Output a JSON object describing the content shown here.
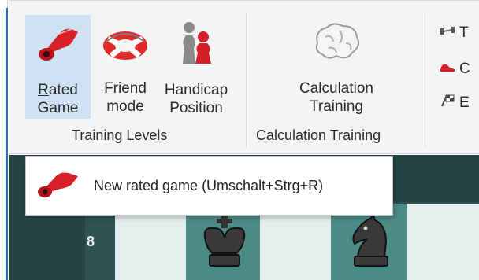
{
  "ribbon": {
    "training_levels": {
      "rated_game": {
        "mnemonic": "R",
        "line1_rest": "ated",
        "line2": "Game",
        "icon": "whistle-icon"
      },
      "friend_mode": {
        "mnemonic": "F",
        "line1_rest": "riend",
        "line2": "mode",
        "icon": "lifebuoy-icon"
      },
      "handicap_position": {
        "line1": "Handicap",
        "line2": "Position",
        "icon": "chess-pawns-icon"
      },
      "group_label": "Training Levels"
    },
    "calculation_training": {
      "button": {
        "line1": "Calculation",
        "line2": "Training",
        "icon": "brain-icon"
      },
      "group_label": "Calculation Training"
    },
    "side_items": [
      {
        "text": "T",
        "icon": "dumbbell-icon"
      },
      {
        "text": "C",
        "icon": "sneaker-icon"
      },
      {
        "text": "E",
        "icon": "checkered-flag-icon"
      }
    ]
  },
  "tooltip": {
    "text": "New rated game (Umschalt+Strg+R)",
    "icon": "whistle-icon"
  },
  "board": {
    "visible_rank": "8",
    "pieces": [
      "black-king",
      "black-knight"
    ]
  },
  "colors": {
    "accent_blue": "#2a6fb4",
    "active_button_bg": "#cfe2f3",
    "board_dark": "#4b8b87",
    "board_light": "#e6efee",
    "frame": "#254543",
    "whistle_red": "#d8202a"
  }
}
